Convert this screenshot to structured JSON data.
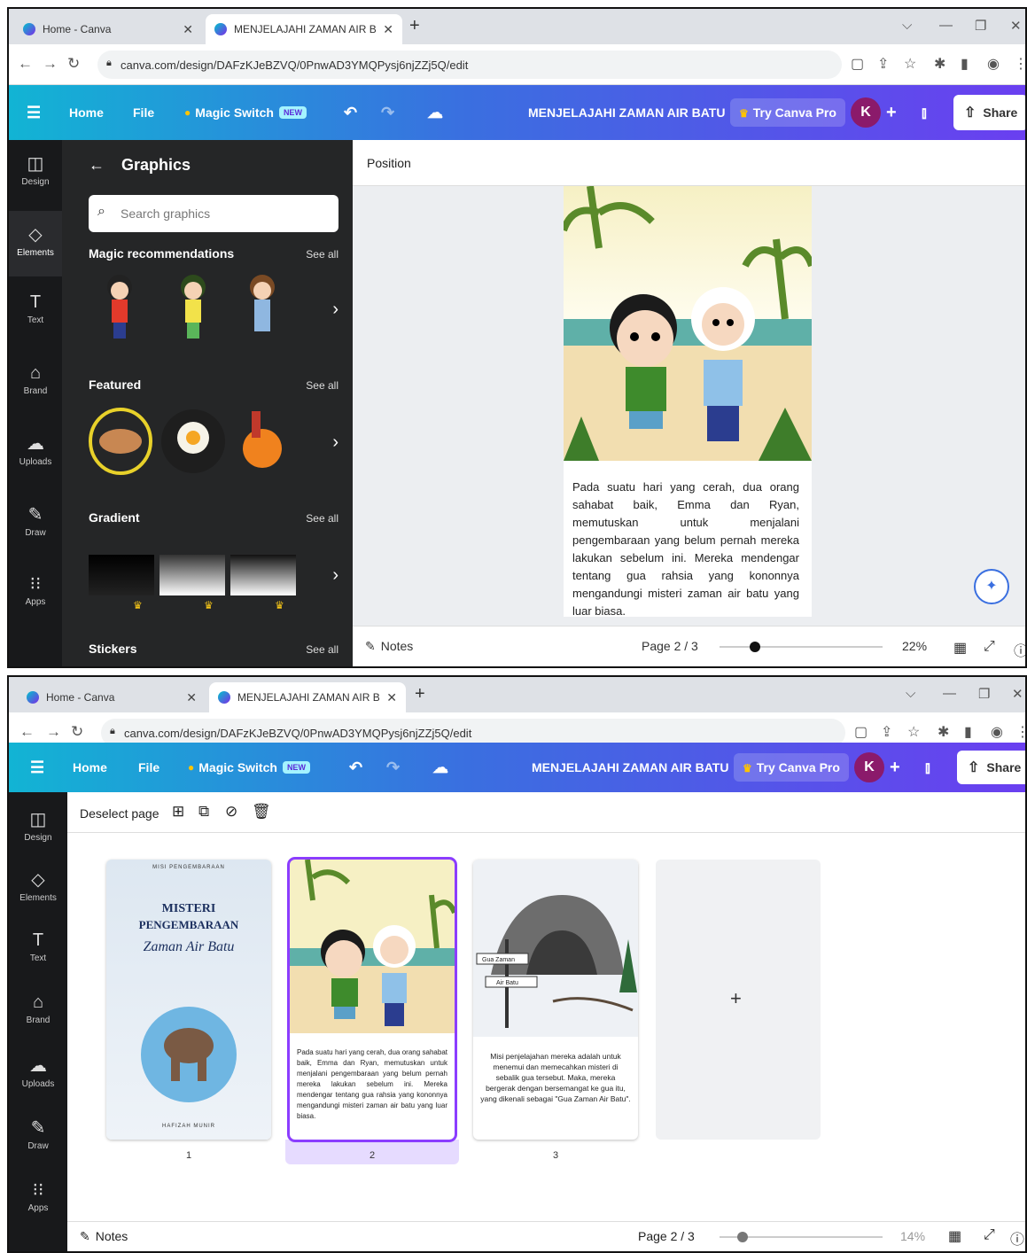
{
  "browser": {
    "tabs": [
      {
        "title": "Home - Canva",
        "active": false
      },
      {
        "title": "MENJELAJAHI ZAMAN AIR BATU",
        "active": true
      }
    ],
    "url": "canva.com/design/DAFzKJeBZVQ/0PnwAD3YMQPysj6njZZj5Q/edit"
  },
  "toolbar": {
    "home": "Home",
    "file": "File",
    "magic_switch": "Magic Switch",
    "new_badge": "NEW",
    "doc_title": "MENJELAJAHI ZAMAN AIR BATU",
    "try_pro": "Try Canva Pro",
    "avatar_letter": "K",
    "share": "Share"
  },
  "rail": [
    {
      "label": "Design",
      "icon": "design-icon"
    },
    {
      "label": "Elements",
      "icon": "elements-icon"
    },
    {
      "label": "Text",
      "icon": "text-icon"
    },
    {
      "label": "Brand",
      "icon": "brand-icon"
    },
    {
      "label": "Uploads",
      "icon": "uploads-icon"
    },
    {
      "label": "Draw",
      "icon": "draw-icon"
    },
    {
      "label": "Apps",
      "icon": "apps-icon"
    }
  ],
  "panel": {
    "title": "Graphics",
    "search_placeholder": "Search graphics",
    "see_all": "See all",
    "sections": [
      "Magic recommendations",
      "Featured",
      "Gradient",
      "Stickers"
    ]
  },
  "editor": {
    "position_label": "Position",
    "story_text": "Pada suatu hari yang cerah, dua orang sahabat baik, Emma dan Ryan, memutuskan untuk menjalani pengembaraan yang belum pernah mereka lakukan sebelum ini. Mereka mendengar tentang gua rahsia yang kononnya mengandungi misteri zaman air batu yang luar biasa.",
    "notes": "Notes",
    "page_indicator": "Page 2 / 3",
    "zoom": "22%",
    "zoom_fraction": 0.22
  },
  "grid_view": {
    "deselect": "Deselect page",
    "page1": {
      "top": "MISI PENGEMBARAAN",
      "title1": "MISTERI",
      "title2": "PENGEMBARAAN",
      "script": "Zaman Air Batu",
      "author": "HAFIZAH MUNIR"
    },
    "page2_text": "Pada suatu hari yang cerah, dua orang sahabat baik, Emma dan Ryan, memutuskan untuk menjalani pengembaraan yang belum pernah mereka lakukan sebelum ini. Mereka mendengar tentang gua rahsia yang kononnya mengandungi misteri zaman air batu yang luar biasa.",
    "page3": {
      "sign1": "Gua Zaman",
      "sign2": "Air Batu",
      "text": "Misi penjelajahan mereka adalah untuk menemui dan memecahkan misteri di sebalik gua tersebut. Maka, mereka bergerak dengan bersemangat ke gua itu, yang dikenali sebagai \"Gua Zaman Air Batu\"."
    },
    "page_numbers": [
      "1",
      "2",
      "3"
    ],
    "add_page": "+",
    "notes": "Notes",
    "page_indicator": "Page 2 / 3",
    "zoom": "14%",
    "zoom_fraction": 0.14
  }
}
